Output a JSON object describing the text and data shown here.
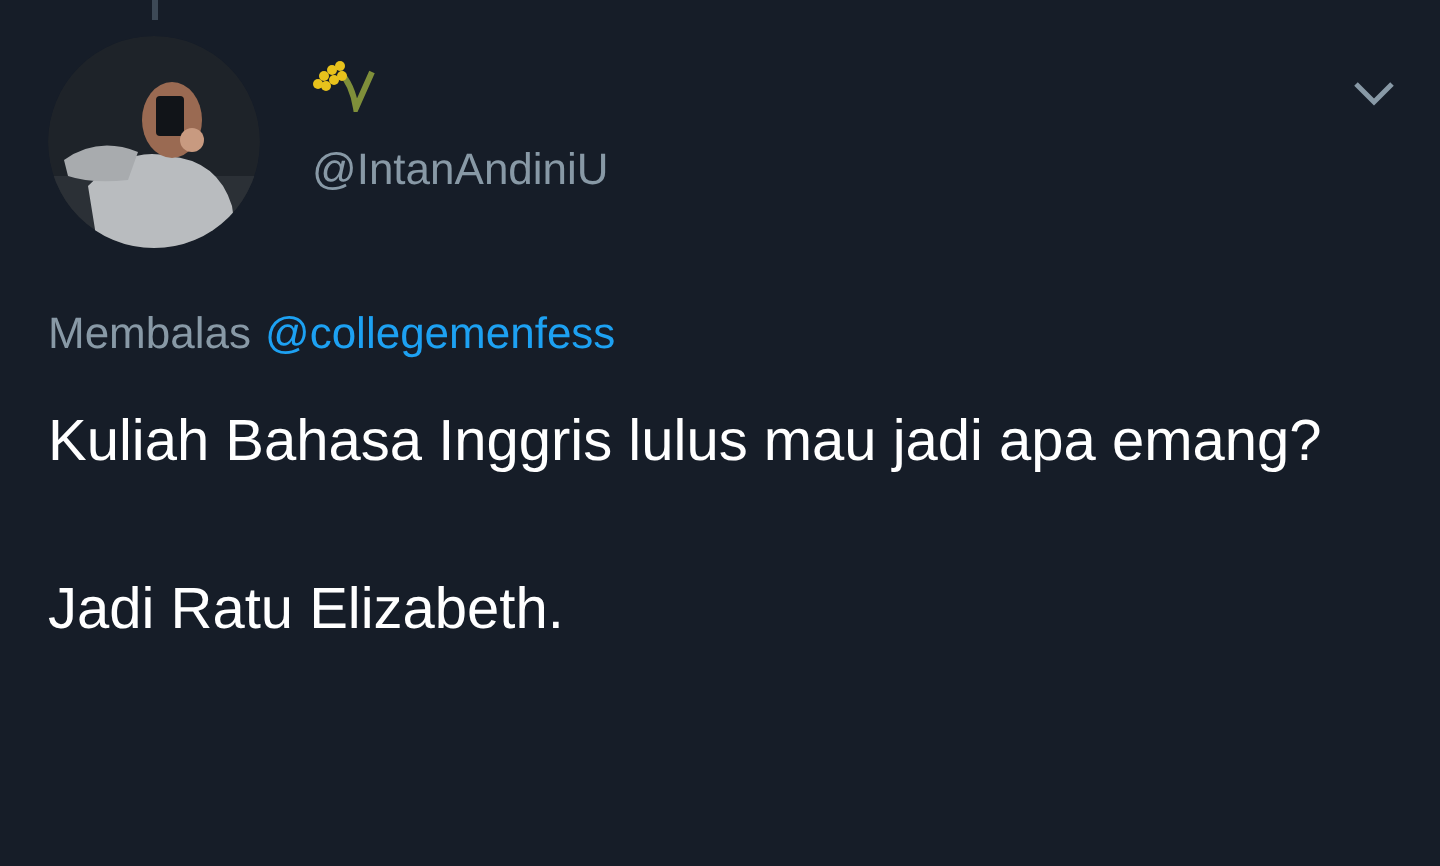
{
  "tweet": {
    "handle": "@IntanAndiniU",
    "reply_prefix": "Membalas",
    "reply_to": "@collegemenfess",
    "text": "Kuliah Bahasa Inggris lulus mau jadi apa emang?\n\nJadi Ratu Elizabeth."
  }
}
